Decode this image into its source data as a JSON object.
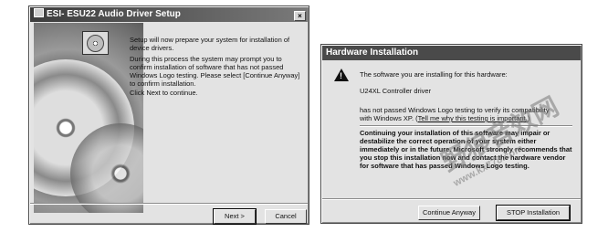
{
  "setup": {
    "title": "ESI- ESU22 Audio Driver Setup",
    "p1": "Setup will now prepare your system for installation of device drivers.",
    "p2": "During this process the system may prompt you to confirm installation of software that has not passed Windows Logo testing. Please select [Continue Anyway] to confirm installation.",
    "p3": "Click Next to continue.",
    "next_label": "Next >",
    "cancel_label": "Cancel"
  },
  "hw": {
    "title": "Hardware Installation",
    "line1": "The software you are installing for this hardware:",
    "device": "U24XL Controller driver",
    "line3a": "has not passed Windows Logo testing to verify its compatibility",
    "line3b": "with Windows XP.",
    "link": "Tell me why this testing is important.",
    "warning": "Continuing your installation of this software may impair or destabilize the correct operation of your system either immediately or in the future. Microsoft strongly recommends that you stop this installation now and contact the hardware vendor for software that has passed Windows Logo testing.",
    "continue_label": "Continue Anyway",
    "stop_label": "STOP Installation"
  },
  "watermark": {
    "cn": "野狼音效网",
    "url": "www.kx778.com"
  }
}
